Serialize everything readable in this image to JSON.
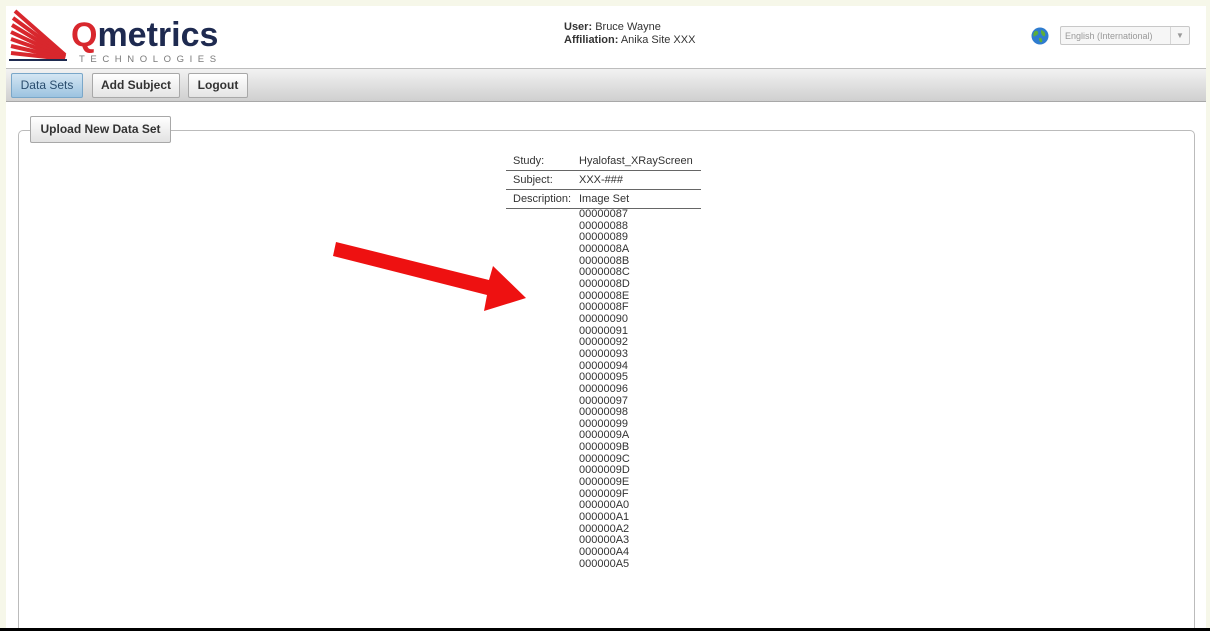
{
  "brand": {
    "name_first_letter": "Q",
    "name_rest": "metrics",
    "tagline": "TECHNOLOGIES",
    "colors": {
      "red": "#d8272d",
      "navy": "#1e2a50"
    }
  },
  "user": {
    "user_label": "User:",
    "user_name": "Bruce Wayne",
    "affiliation_label": "Affiliation:",
    "affiliation": "Anika Site XXX"
  },
  "language": {
    "icon": "globe-icon",
    "selected": "English (International)"
  },
  "nav": {
    "tabs": [
      {
        "label": "Data Sets",
        "active": true
      },
      {
        "label": "Add Subject",
        "active": false
      },
      {
        "label": "Logout",
        "active": false
      }
    ]
  },
  "main": {
    "upload_button": "Upload New Data Set",
    "info": [
      {
        "key": "Study:",
        "value": "Hyalofast_XRayScreen"
      },
      {
        "key": "Subject:",
        "value": "XXX-###"
      },
      {
        "key": "Description:",
        "value": "Image Set"
      }
    ],
    "images": [
      "00000087",
      "00000088",
      "00000089",
      "0000008A",
      "0000008B",
      "0000008C",
      "0000008D",
      "0000008E",
      "0000008F",
      "00000090",
      "00000091",
      "00000092",
      "00000093",
      "00000094",
      "00000095",
      "00000096",
      "00000097",
      "00000098",
      "00000099",
      "0000009A",
      "0000009B",
      "0000009C",
      "0000009D",
      "0000009E",
      "0000009F",
      "000000A0",
      "000000A1",
      "000000A2",
      "000000A3",
      "000000A4",
      "000000A5"
    ],
    "annotation": {
      "icon": "red-arrow-annotation",
      "color": "#ee1111"
    }
  }
}
